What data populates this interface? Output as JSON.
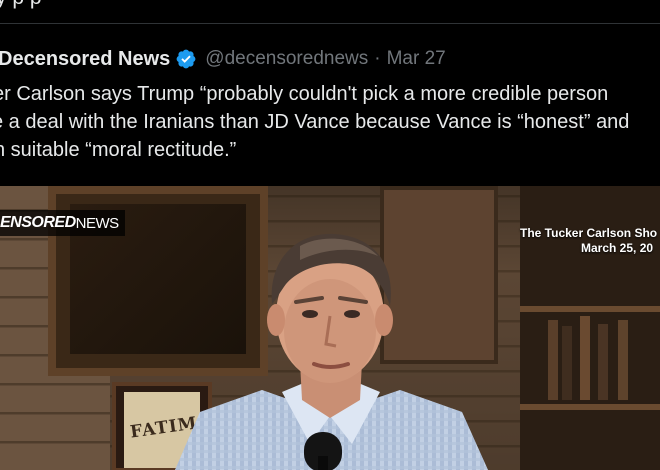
{
  "previous_tweet": {
    "partial_text": "y            p      p"
  },
  "tweet": {
    "author_name": "Decensored News",
    "verified_icon": "verified-badge-icon",
    "handle": "@decensorednews",
    "separator": "·",
    "date": "Mar 27",
    "text_lines": [
      "er Carlson says Trump “probably couldn't pick a more credible person",
      "e a deal with the Iranians than JD Vance because Vance is “honest” and",
      "n suitable “moral rectitude.”"
    ]
  },
  "media": {
    "watermark_bold": "ENSORED",
    "watermark_light": "NEWS",
    "show_title": "The Tucker Carlson Sho",
    "show_date": "March 25, 20",
    "poster_text": "FATIM"
  },
  "colors": {
    "background": "#000000",
    "text": "#e7e9ea",
    "secondary_text": "#71767b",
    "verified_blue": "#1d9bf0",
    "divider": "#2f3336"
  }
}
